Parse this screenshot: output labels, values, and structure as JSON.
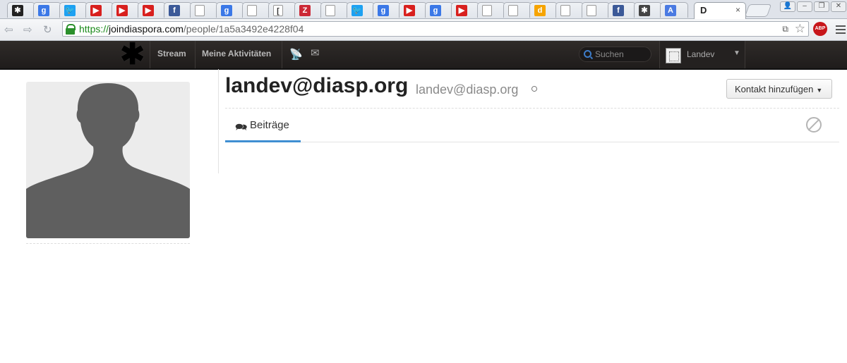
{
  "browser": {
    "active_tab_title": "D",
    "active_tab_close": "×",
    "favicons": [
      {
        "name": "tab-favicon-diaspora",
        "color": "#222222",
        "glyph": "✱"
      },
      {
        "name": "tab-favicon-google",
        "color": "#3b78e7",
        "glyph": "g"
      },
      {
        "name": "tab-favicon-twitter",
        "color": "#1da1f2",
        "glyph": "🐦"
      },
      {
        "name": "tab-favicon-youtube",
        "color": "#d8201e",
        "glyph": "▶"
      },
      {
        "name": "tab-favicon-youtube",
        "color": "#d8201e",
        "glyph": "▶"
      },
      {
        "name": "tab-favicon-youtube",
        "color": "#d8201e",
        "glyph": "▶"
      },
      {
        "name": "tab-favicon-facebook",
        "color": "#3b5998",
        "glyph": "f"
      },
      {
        "name": "tab-favicon-page",
        "color": "#ffffff",
        "glyph": ""
      },
      {
        "name": "tab-favicon-google",
        "color": "#3b78e7",
        "glyph": "g"
      },
      {
        "name": "tab-favicon-page",
        "color": "#ffffff",
        "glyph": ""
      },
      {
        "name": "tab-favicon-audio",
        "color": "#ffffff",
        "glyph": "["
      },
      {
        "name": "tab-favicon-zotero",
        "color": "#cc2936",
        "glyph": "Z"
      },
      {
        "name": "tab-favicon-page",
        "color": "#ffffff",
        "glyph": ""
      },
      {
        "name": "tab-favicon-twitter",
        "color": "#1da1f2",
        "glyph": "🐦"
      },
      {
        "name": "tab-favicon-google",
        "color": "#3b78e7",
        "glyph": "g"
      },
      {
        "name": "tab-favicon-youtube",
        "color": "#d8201e",
        "glyph": "▶"
      },
      {
        "name": "tab-favicon-google",
        "color": "#3b78e7",
        "glyph": "g"
      },
      {
        "name": "tab-favicon-youtube",
        "color": "#d8201e",
        "glyph": "▶"
      },
      {
        "name": "tab-favicon-page",
        "color": "#ffffff",
        "glyph": ""
      },
      {
        "name": "tab-favicon-page",
        "color": "#ffffff",
        "glyph": ""
      },
      {
        "name": "tab-favicon-disqus",
        "color": "#f6a400",
        "glyph": "d"
      },
      {
        "name": "tab-favicon-page",
        "color": "#ffffff",
        "glyph": ""
      },
      {
        "name": "tab-favicon-page",
        "color": "#ffffff",
        "glyph": ""
      },
      {
        "name": "tab-favicon-facebook",
        "color": "#3b5998",
        "glyph": "f"
      },
      {
        "name": "tab-favicon-settings",
        "color": "#444444",
        "glyph": "✱"
      },
      {
        "name": "tab-favicon-translate",
        "color": "#4a7ae2",
        "glyph": "A"
      }
    ],
    "url": {
      "scheme": "https://",
      "host": "joindiaspora.com",
      "path": "/people/1a5a3492e4228f04"
    },
    "adblock_label": "ABP"
  },
  "diaspora": {
    "nav": {
      "stream": "Stream",
      "activity": "Meine Aktivitäten"
    },
    "search_placeholder": "Suchen",
    "username": "Landev",
    "user_caret": "▼"
  },
  "profile": {
    "name": "landev@diasp.org",
    "handle": "landev@diasp.org",
    "add_contact_label": "Kontakt hinzufügen",
    "add_contact_caret": "▼",
    "tabs": {
      "posts": "Beiträge"
    }
  },
  "colors": {
    "accent": "#3f8fd2",
    "header_bg": "#2a2625",
    "silhouette": "#5f5f5f",
    "avatar_bg": "#ececec"
  }
}
